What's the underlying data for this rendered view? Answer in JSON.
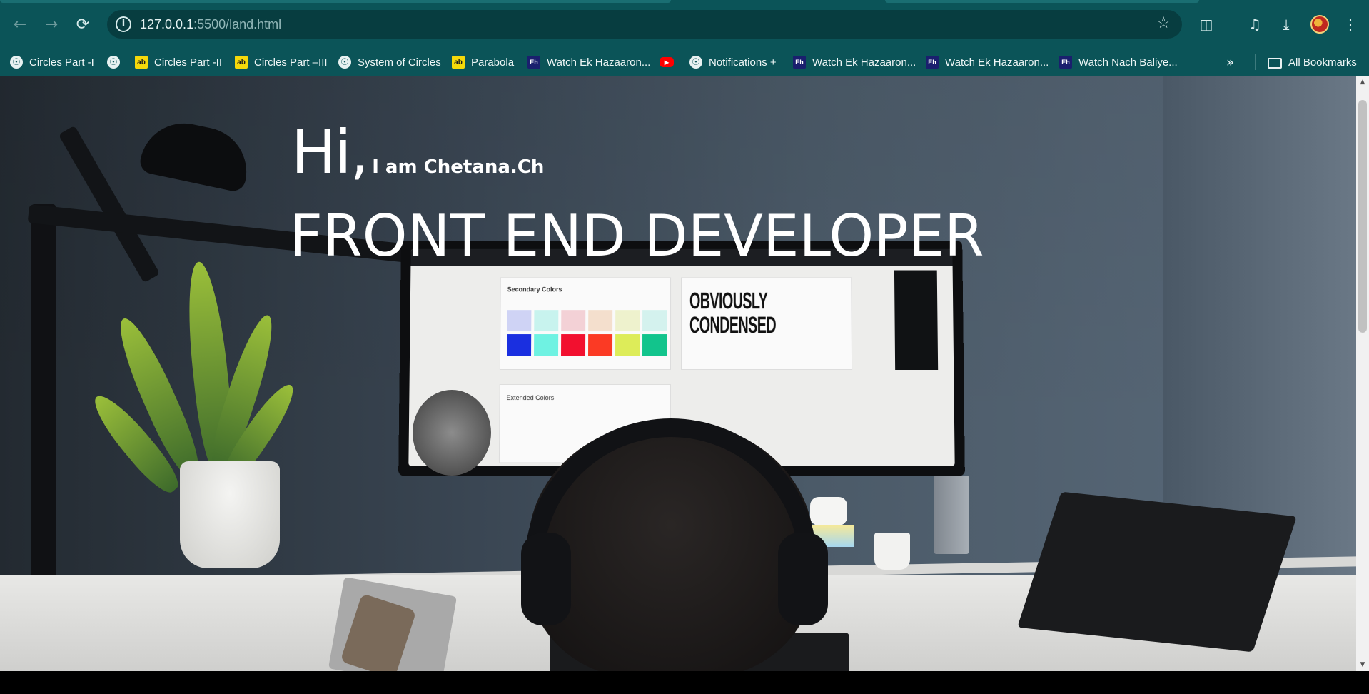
{
  "browser": {
    "nav": {
      "back_icon": "arrow-left-icon",
      "forward_icon": "arrow-right-icon",
      "reload_icon": "reload-icon"
    },
    "address": {
      "host": "127.0.0.1",
      "path": ":5500/land.html"
    },
    "toolbar_icons": [
      "star-icon",
      "extensions-icon",
      "media-icon",
      "download-icon",
      "profile-avatar",
      "menu-icon"
    ],
    "bookmarks": [
      {
        "label": "Circles Part -I",
        "icon": "globe-icon"
      },
      {
        "label": "",
        "icon": "globe-icon"
      },
      {
        "label": "Circles Part -II",
        "icon": "site-icon"
      },
      {
        "label": "Circles Part –III",
        "icon": "site-icon"
      },
      {
        "label": "System of Circles",
        "icon": "globe-icon"
      },
      {
        "label": "Parabola",
        "icon": "site-icon"
      },
      {
        "label": "Watch Ek Hazaaron...",
        "icon": "eh-icon"
      },
      {
        "label": "",
        "icon": "youtube-icon"
      },
      {
        "label": "Notifications +",
        "icon": "globe-icon"
      },
      {
        "label": "Watch Ek Hazaaron...",
        "icon": "eh-icon"
      },
      {
        "label": "Watch Ek Hazaaron...",
        "icon": "eh-icon"
      },
      {
        "label": "Watch Nach Baliye...",
        "icon": "eh-icon"
      }
    ],
    "all_bookmarks": "All Bookmarks"
  },
  "page": {
    "greeting": "Hi,",
    "intro": "I am Chetana.Ch",
    "role": "FRONT END DEVELOPER",
    "screen_text": {
      "obviously": "OBVIOUSLY",
      "condensed": "CONDENSED",
      "secondary": "Secondary Colors",
      "extended": "Extended Colors"
    }
  },
  "colors": {
    "chrome": "#0b5458",
    "omnibox": "#073d40",
    "hero_text": "#ffffff"
  }
}
